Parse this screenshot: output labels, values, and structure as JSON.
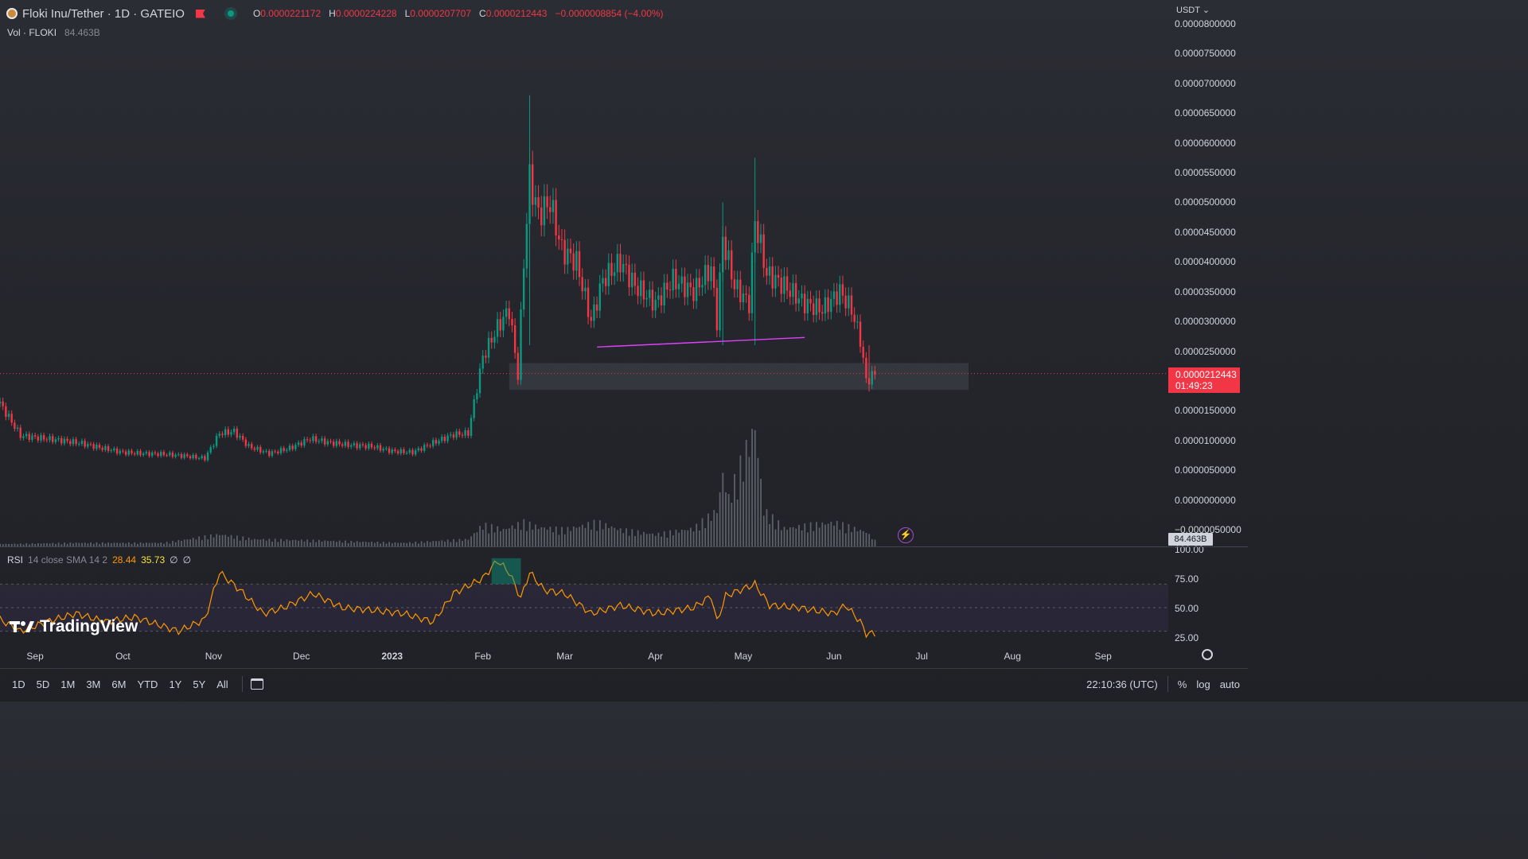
{
  "header": {
    "title": "Floki Inu/Tether · 1D · GATEIO",
    "ohlc": [
      {
        "k": "O",
        "v": "0.0000221172"
      },
      {
        "k": "H",
        "v": "0.0000224228"
      },
      {
        "k": "L",
        "v": "0.0000207707"
      },
      {
        "k": "C",
        "v": "0.0000212443"
      }
    ],
    "change": "−0.0000008854 (−4.00%)"
  },
  "volume_label": {
    "name": "Vol · FLOKI",
    "value": "84.463B"
  },
  "currency": "USDT",
  "price_ticks": [
    "0.0000800000",
    "0.0000750000",
    "0.0000700000",
    "0.0000650000",
    "0.0000600000",
    "0.0000550000",
    "0.0000500000",
    "0.0000450000",
    "0.0000400000",
    "0.0000350000",
    "0.0000300000",
    "0.0000250000",
    "0.0000150000",
    "0.0000100000",
    "0.0000050000",
    "0.0000000000",
    "−0.0000050000"
  ],
  "last_price": {
    "value": "0.0000212443",
    "countdown": "01:49:23"
  },
  "volume_badge": "84.463B",
  "rsi_label": {
    "name": "RSI",
    "params": "14 close SMA 14 2",
    "rsi": "28.44",
    "sma": "35.73",
    "extra1": "∅",
    "extra2": "∅"
  },
  "rsi_ticks": [
    "100.00",
    "75.00",
    "50.00",
    "25.00"
  ],
  "time_labels": [
    "Sep",
    "Oct",
    "Nov",
    "Dec",
    "2023",
    "Feb",
    "Mar",
    "Apr",
    "May",
    "Jun",
    "Jul",
    "Aug",
    "Sep"
  ],
  "watermark": "TradingView",
  "timeframes": [
    "1D",
    "5D",
    "1M",
    "3M",
    "6M",
    "YTD",
    "1Y",
    "5Y",
    "All"
  ],
  "clock": "22:10:36 (UTC)",
  "bottom_right": {
    "percent": "%",
    "log": "log",
    "auto": "auto"
  },
  "colors": {
    "up": "#089981",
    "down": "#f23645",
    "rsi": "#ff9800",
    "trendline": "#e040fb"
  },
  "chart_data": {
    "type": "candlestick",
    "ylim": [
      -5e-06,
      8e-05
    ],
    "price_series": [
      [
        "2022-08-20",
        1.62e-05
      ],
      [
        "2022-08-27",
        1.08e-05
      ],
      [
        "2022-09-03",
        1.04e-05
      ],
      [
        "2022-09-10",
        1e-05
      ],
      [
        "2022-09-17",
        9.5e-06
      ],
      [
        "2022-09-24",
        8.7e-06
      ],
      [
        "2022-10-01",
        8e-06
      ],
      [
        "2022-10-08",
        7.8e-06
      ],
      [
        "2022-10-15",
        7.7e-06
      ],
      [
        "2022-10-22",
        7.4e-06
      ],
      [
        "2022-10-29",
        7e-06
      ],
      [
        "2022-11-03",
        1.12e-05
      ],
      [
        "2022-11-08",
        1.15e-05
      ],
      [
        "2022-11-13",
        9e-06
      ],
      [
        "2022-11-20",
        7.8e-06
      ],
      [
        "2022-11-27",
        8.7e-06
      ],
      [
        "2022-12-04",
        1.03e-05
      ],
      [
        "2022-12-11",
        9.6e-06
      ],
      [
        "2022-12-18",
        9.2e-06
      ],
      [
        "2022-12-25",
        9e-06
      ],
      [
        "2023-01-01",
        8.2e-06
      ],
      [
        "2023-01-08",
        8e-06
      ],
      [
        "2023-01-15",
        9.6e-06
      ],
      [
        "2023-01-22",
        1.1e-05
      ],
      [
        "2023-01-27",
        1.12e-05
      ],
      [
        "2023-02-01",
        2.4e-05
      ],
      [
        "2023-02-06",
        2.9e-05
      ],
      [
        "2023-02-10",
        3.2e-05
      ],
      [
        "2023-02-13",
        2.1e-05
      ],
      [
        "2023-02-15",
        4e-05
      ],
      [
        "2023-02-17",
        5.4e-05
      ],
      [
        "2023-02-20",
        4.8e-05
      ],
      [
        "2023-02-24",
        5e-05
      ],
      [
        "2023-02-28",
        4.2e-05
      ],
      [
        "2023-03-05",
        4e-05
      ],
      [
        "2023-03-10",
        3e-05
      ],
      [
        "2023-03-14",
        3.7e-05
      ],
      [
        "2023-03-20",
        4e-05
      ],
      [
        "2023-03-25",
        3.6e-05
      ],
      [
        "2023-04-01",
        3.3e-05
      ],
      [
        "2023-04-07",
        3.7e-05
      ],
      [
        "2023-04-14",
        3.5e-05
      ],
      [
        "2023-04-20",
        3.9e-05
      ],
      [
        "2023-04-22",
        3e-05
      ],
      [
        "2023-04-24",
        4.4e-05
      ],
      [
        "2023-04-28",
        3.6e-05
      ],
      [
        "2023-05-03",
        3.3e-05
      ],
      [
        "2023-05-05",
        4.7e-05
      ],
      [
        "2023-05-09",
        3.8e-05
      ],
      [
        "2023-05-15",
        3.6e-05
      ],
      [
        "2023-05-22",
        3.3e-05
      ],
      [
        "2023-05-28",
        3.2e-05
      ],
      [
        "2023-06-03",
        3.5e-05
      ],
      [
        "2023-06-07",
        3.2e-05
      ],
      [
        "2023-06-10",
        2.7e-05
      ],
      [
        "2023-06-12",
        2e-05
      ],
      [
        "2023-06-15",
        2.12e-05
      ]
    ],
    "support_zone": [
      1.85e-05,
      2.3e-05
    ],
    "trendline": [
      [
        "2023-03-12",
        2.57e-05
      ],
      [
        "2023-05-22",
        2.73e-05
      ]
    ],
    "volume_series": [
      [
        "2022-08-20",
        0.02
      ],
      [
        "2022-09-15",
        0.03
      ],
      [
        "2022-10-15",
        0.03
      ],
      [
        "2022-11-03",
        0.1
      ],
      [
        "2022-11-15",
        0.06
      ],
      [
        "2022-12-05",
        0.05
      ],
      [
        "2023-01-05",
        0.03
      ],
      [
        "2023-01-27",
        0.06
      ],
      [
        "2023-02-01",
        0.18
      ],
      [
        "2023-02-08",
        0.14
      ],
      [
        "2023-02-15",
        0.2
      ],
      [
        "2023-02-20",
        0.16
      ],
      [
        "2023-03-01",
        0.14
      ],
      [
        "2023-03-12",
        0.2
      ],
      [
        "2023-03-20",
        0.14
      ],
      [
        "2023-04-01",
        0.1
      ],
      [
        "2023-04-14",
        0.15
      ],
      [
        "2023-04-22",
        0.3
      ],
      [
        "2023-04-24",
        0.6
      ],
      [
        "2023-04-26",
        0.4
      ],
      [
        "2023-05-05",
        1.0
      ],
      [
        "2023-05-08",
        0.3
      ],
      [
        "2023-05-15",
        0.15
      ],
      [
        "2023-06-01",
        0.2
      ],
      [
        "2023-06-12",
        0.12
      ],
      [
        "2023-06-15",
        0.05
      ]
    ],
    "rsi_series": [
      [
        "2022-08-20",
        40
      ],
      [
        "2022-08-27",
        30
      ],
      [
        "2022-09-05",
        38
      ],
      [
        "2022-09-15",
        45
      ],
      [
        "2022-09-25",
        38
      ],
      [
        "2022-10-05",
        42
      ],
      [
        "2022-10-20",
        30
      ],
      [
        "2022-10-29",
        40
      ],
      [
        "2022-11-03",
        80
      ],
      [
        "2022-11-10",
        65
      ],
      [
        "2022-11-18",
        45
      ],
      [
        "2022-11-25",
        50
      ],
      [
        "2022-12-05",
        62
      ],
      [
        "2022-12-15",
        50
      ],
      [
        "2022-12-25",
        48
      ],
      [
        "2023-01-05",
        45
      ],
      [
        "2023-01-15",
        38
      ],
      [
        "2023-01-22",
        62
      ],
      [
        "2023-01-28",
        70
      ],
      [
        "2023-02-01",
        75
      ],
      [
        "2023-02-06",
        90
      ],
      [
        "2023-02-10",
        80
      ],
      [
        "2023-02-14",
        58
      ],
      [
        "2023-02-17",
        80
      ],
      [
        "2023-02-22",
        65
      ],
      [
        "2023-03-01",
        62
      ],
      [
        "2023-03-10",
        45
      ],
      [
        "2023-03-20",
        52
      ],
      [
        "2023-04-01",
        45
      ],
      [
        "2023-04-14",
        50
      ],
      [
        "2023-04-20",
        60
      ],
      [
        "2023-04-22",
        38
      ],
      [
        "2023-04-25",
        60
      ],
      [
        "2023-05-05",
        70
      ],
      [
        "2023-05-10",
        52
      ],
      [
        "2023-05-20",
        50
      ],
      [
        "2023-06-01",
        45
      ],
      [
        "2023-06-05",
        52
      ],
      [
        "2023-06-10",
        38
      ],
      [
        "2023-06-12",
        28
      ],
      [
        "2023-06-15",
        28
      ]
    ],
    "rsi_sma_series": [
      [
        "2023-02-05",
        82
      ],
      [
        "2023-02-12",
        78
      ]
    ],
    "rsi_bands": [
      30,
      70
    ]
  }
}
